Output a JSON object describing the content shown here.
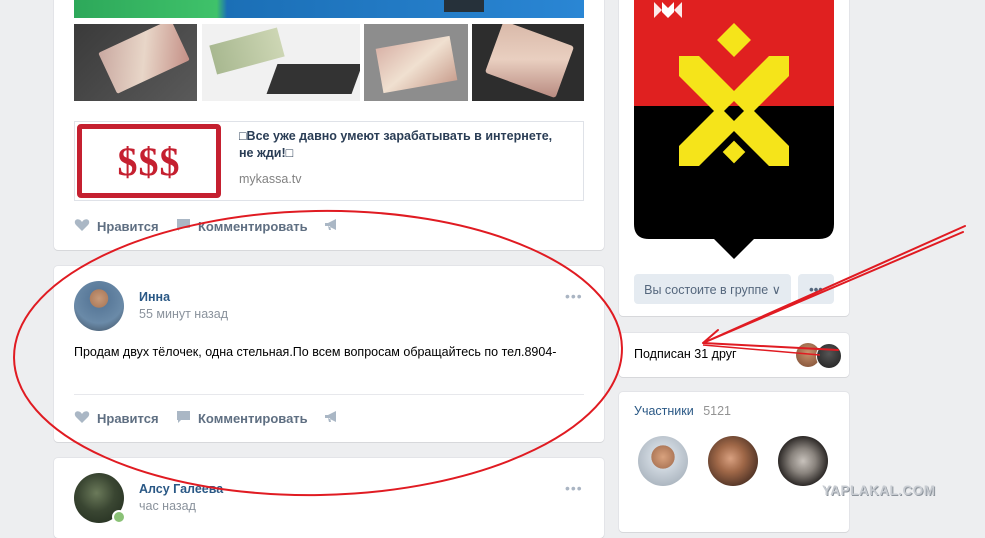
{
  "post1": {
    "link_card": {
      "thumb_text": "$$$",
      "title": "□Все уже давно умеют зарабатывать в интернете, не жди!□",
      "domain": "mykassa.tv"
    },
    "actions": {
      "like": "Нравится",
      "comment": "Комментировать"
    }
  },
  "post2": {
    "author": "Инна",
    "time": "55 минут назад",
    "text": "Продам двух тёлочек, одна стельная.По всем вопросам обращайтесь по тел.8904-",
    "actions": {
      "like": "Нравится",
      "comment": "Комментировать"
    }
  },
  "post3": {
    "author": "Алсу Галеева",
    "time": "час назад"
  },
  "sidebar": {
    "join_button": "Вы состоите в группе ∨",
    "friends_label": "Подписан 31 друг",
    "members_label": "Участники",
    "members_count": "5121"
  },
  "watermark": "YAPLAKAL.COM",
  "colors": {
    "link": "#2a5885",
    "annotation": "#e01b22",
    "flag_red": "#e02020",
    "flag_yellow": "#f5e41a"
  },
  "icons": [
    "heart-icon",
    "comment-icon",
    "share-megaphone-icon",
    "more-dots-icon"
  ]
}
